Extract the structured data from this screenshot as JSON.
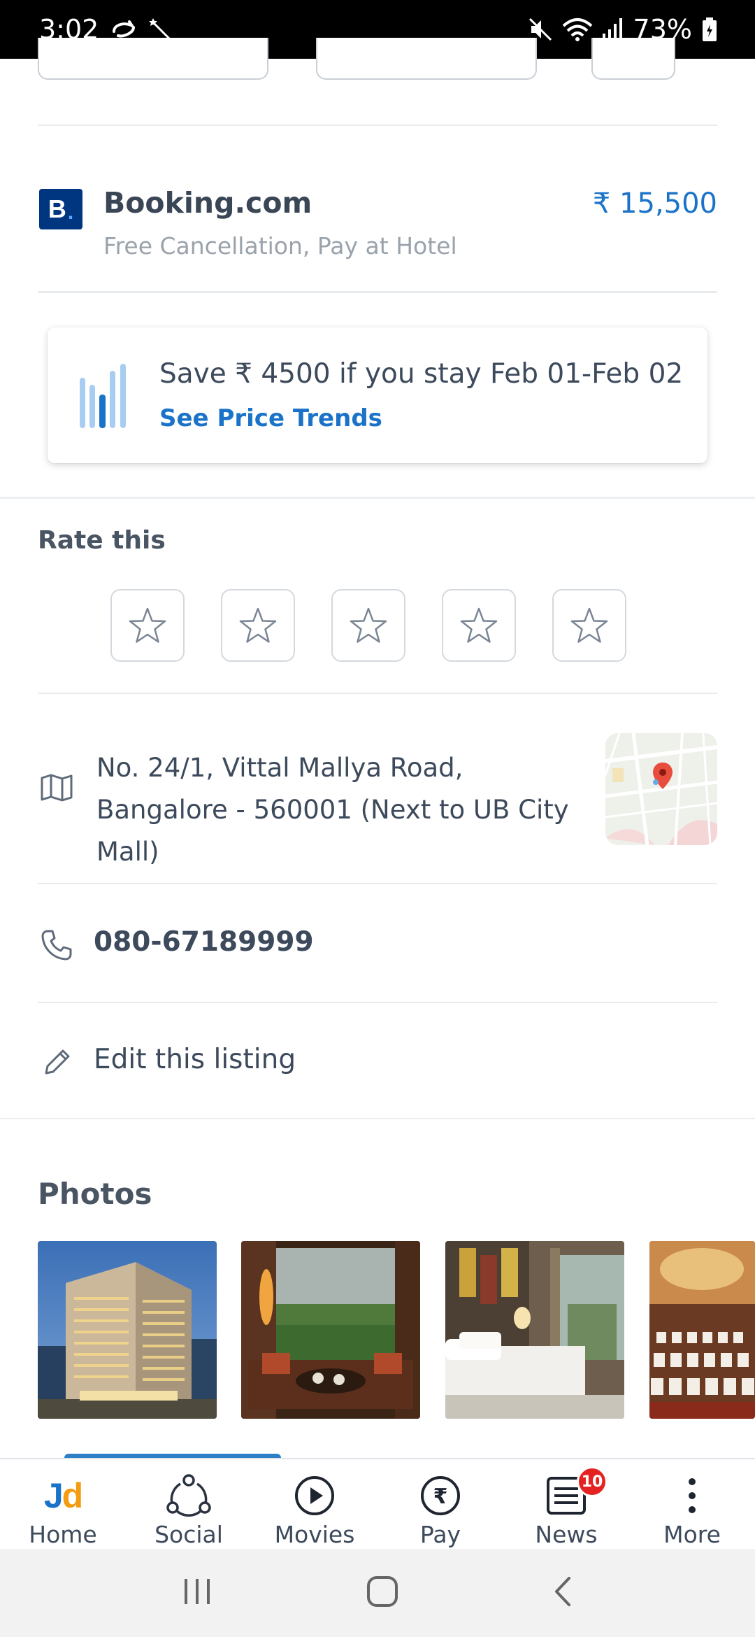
{
  "status_bar": {
    "time": "3:02",
    "battery": "73%"
  },
  "booking": {
    "logo_letter": "B",
    "logo_dot": ".",
    "name": "Booking.com",
    "subtitle": "Free Cancellation, Pay at Hotel",
    "price": "₹ 15,500"
  },
  "price_trend": {
    "message": "Save ₹ 4500 if you stay Feb 01-Feb 02",
    "link": "See Price Trends"
  },
  "rating": {
    "title": "Rate this",
    "stars": 5,
    "value": 0
  },
  "address": {
    "text": "No. 24/1, Vittal Mallya Road, Bangalore - 560001 (Next to UB City Mall)"
  },
  "phone": {
    "number": "080-67189999"
  },
  "edit": {
    "label": "Edit this listing"
  },
  "photos": {
    "title": "Photos"
  },
  "bottom_nav": {
    "items": [
      {
        "label": "Home",
        "icon": "jd-logo-icon"
      },
      {
        "label": "Social",
        "icon": "social-icon"
      },
      {
        "label": "Movies",
        "icon": "play-icon"
      },
      {
        "label": "Pay",
        "icon": "rupee-icon"
      },
      {
        "label": "News",
        "icon": "news-icon",
        "badge": "10"
      },
      {
        "label": "More",
        "icon": "more-icon"
      }
    ]
  },
  "colors": {
    "accent": "#1a73c8",
    "booking_brand": "#003580",
    "badge": "#e52222",
    "text": "#3d4a5c",
    "muted": "#9aa2ab"
  }
}
